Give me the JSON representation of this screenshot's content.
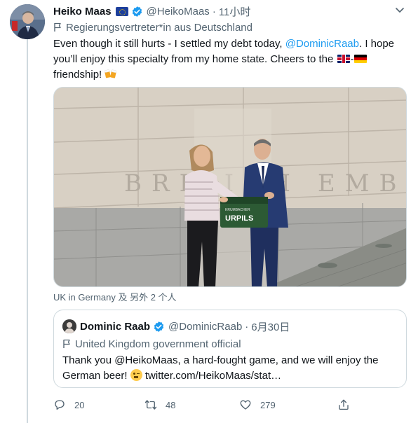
{
  "tweet": {
    "author": {
      "display_name": "Heiko Maas",
      "handle": "@HeikoMaas",
      "time": "11小时",
      "dot": "·",
      "label": "Regierungsvertreter*in aus Deutschland"
    },
    "text": {
      "part1": "Even though it still hurts - I settled my debt today, ",
      "mention": "@DominicRaab",
      "part2": ". I hope you’ll enjoy this specialty from my home state. Cheers to the ",
      "dash": "-",
      "part3": " friendship! "
    },
    "photo": {
      "wall_text": "BRITISH EMBASSY",
      "crate_brand_small": "KRUMBACHER",
      "crate_brand": "URPILS"
    },
    "tagged": "UK in Germany 及 另外 2 个人",
    "quote": {
      "display_name": "Dominic Raab",
      "handle": "@DominicRaab",
      "dot": "·",
      "date": "6月30日",
      "label": "United Kingdom government official",
      "text_part1": "Thank you @HeikoMaas, a hard-fought game, and we will enjoy the German beer! ",
      "text_link": "twitter.com/HeikoMaas/stat…"
    },
    "actions": {
      "replies": "20",
      "retweets": "48",
      "likes": "279"
    }
  },
  "colors": {
    "link": "#1d9bf0",
    "secondary_text": "#536471",
    "border": "#cfd9de",
    "verified": "#1d9bf0"
  },
  "icons": [
    "verified-badge-icon",
    "eu-flag-icon",
    "flag-icon",
    "uk-flag-icon",
    "german-flag-icon",
    "beer-mugs-icon",
    "wink-face-icon",
    "reply-icon",
    "retweet-icon",
    "like-icon",
    "share-icon",
    "chevron-down-icon"
  ]
}
